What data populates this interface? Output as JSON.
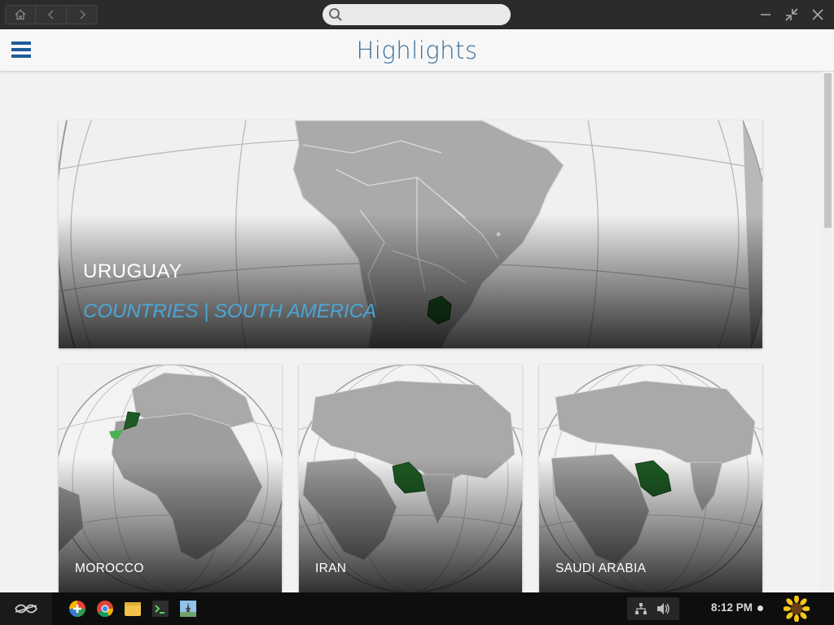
{
  "browser": {
    "search_placeholder": ""
  },
  "header": {
    "title": "Highlights"
  },
  "featured": {
    "title": "URUGUAY",
    "subtitle": "COUNTRIES | SOUTH AMERICA"
  },
  "cards": [
    {
      "title": "MOROCCO"
    },
    {
      "title": "IRAN"
    },
    {
      "title": "SAUDI ARABIA"
    }
  ],
  "taskbar": {
    "apps": [
      "software-center",
      "chrome",
      "file-manager",
      "terminal",
      "image-viewer"
    ],
    "clock": "8:12 PM"
  },
  "colors": {
    "title_bar": "#2b2b2b",
    "header_title": "#3b6d97",
    "menu_icon": "#1f5a99",
    "subtitle_accent": "#4aa6d6",
    "highlight_country": "#1d5a24",
    "taskbar": "#0e0e0e"
  }
}
